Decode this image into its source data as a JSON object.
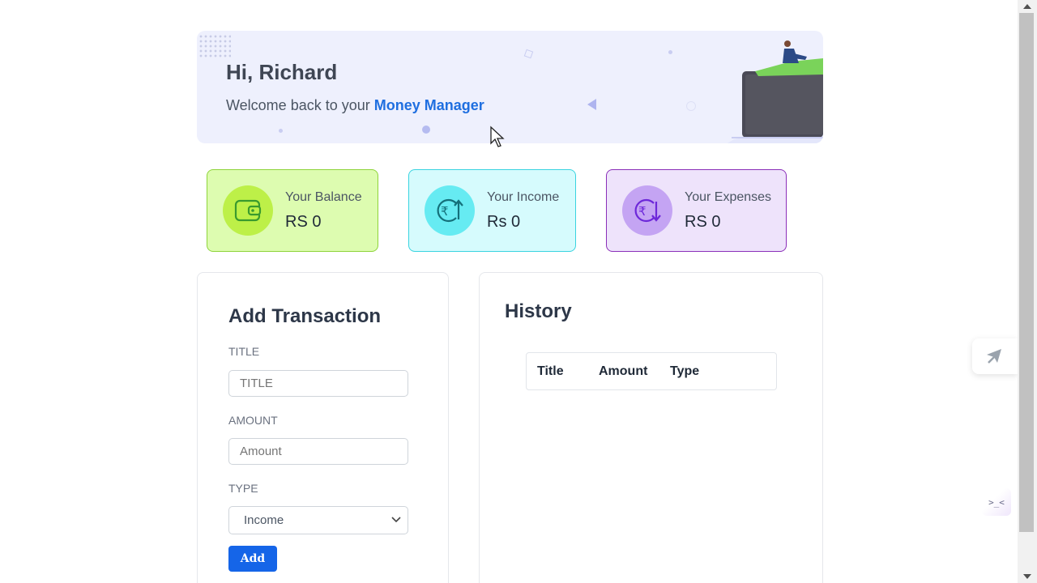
{
  "banner": {
    "greeting": "Hi, Richard",
    "welcome_prefix": "Welcome back to your ",
    "brand": "Money Manager"
  },
  "stats": {
    "balance": {
      "label": "Your Balance",
      "value": "RS 0",
      "icon": "wallet-icon"
    },
    "income": {
      "label": "Your Income",
      "value": "Rs 0",
      "icon": "rupee-up-icon"
    },
    "expenses": {
      "label": "Your Expenses",
      "value": "RS 0",
      "icon": "rupee-down-icon"
    }
  },
  "add_transaction": {
    "title": "Add Transaction",
    "title_label": "TITLE",
    "title_placeholder": "TITLE",
    "amount_label": "AMOUNT",
    "amount_placeholder": "Amount",
    "type_label": "TYPE",
    "type_selected": "Income",
    "add_button": "Add"
  },
  "history": {
    "title": "History",
    "columns": [
      "Title",
      "Amount",
      "Type"
    ]
  },
  "side_widget2_text": ">_<",
  "colors": {
    "brand_blue": "#1f6fe0",
    "button_blue": "#1565e8",
    "balance_bg": "#ddfcb0",
    "income_bg": "#d6fbfd",
    "expense_bg": "#eee3fb"
  }
}
